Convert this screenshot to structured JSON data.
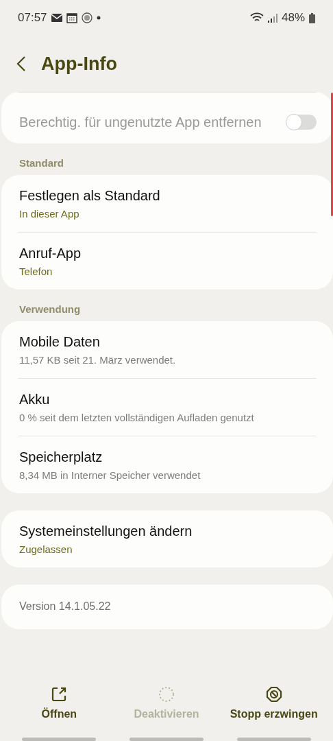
{
  "status_bar": {
    "time": "07:57",
    "battery": "48%"
  },
  "header": {
    "title": "App-Info"
  },
  "groups": [
    {
      "items": [
        {
          "kind": "toggle",
          "title": "Berechtig. für ungenutzte App entfernen",
          "disabled": true,
          "on": false
        }
      ]
    },
    {
      "heading": "Standard",
      "items": [
        {
          "kind": "value",
          "title": "Festlegen als Standard",
          "subtitle": "In dieser App"
        },
        {
          "kind": "value",
          "title": "Anruf-App",
          "subtitle": "Telefon"
        }
      ]
    },
    {
      "heading": "Verwendung",
      "items": [
        {
          "kind": "usage",
          "title": "Mobile Daten",
          "subtitle": "11,57 KB seit 21. März verwendet."
        },
        {
          "kind": "usage",
          "title": "Akku",
          "subtitle": "0 % seit dem letzten vollständigen Aufladen genutzt"
        },
        {
          "kind": "usage",
          "title": "Speicherplatz",
          "subtitle": "8,34 MB in Interner Speicher verwendet"
        }
      ]
    },
    {
      "items": [
        {
          "kind": "value",
          "title": "Systemeinstellungen ändern",
          "subtitle": "Zugelassen"
        }
      ]
    },
    {
      "items": [
        {
          "kind": "info",
          "title": "Version 14.1.05.22"
        }
      ]
    }
  ],
  "actions": [
    {
      "label": "Öffnen",
      "disabled": false
    },
    {
      "label": "Deaktivieren",
      "disabled": true
    },
    {
      "label": "Stopp erzwingen",
      "disabled": false
    }
  ]
}
